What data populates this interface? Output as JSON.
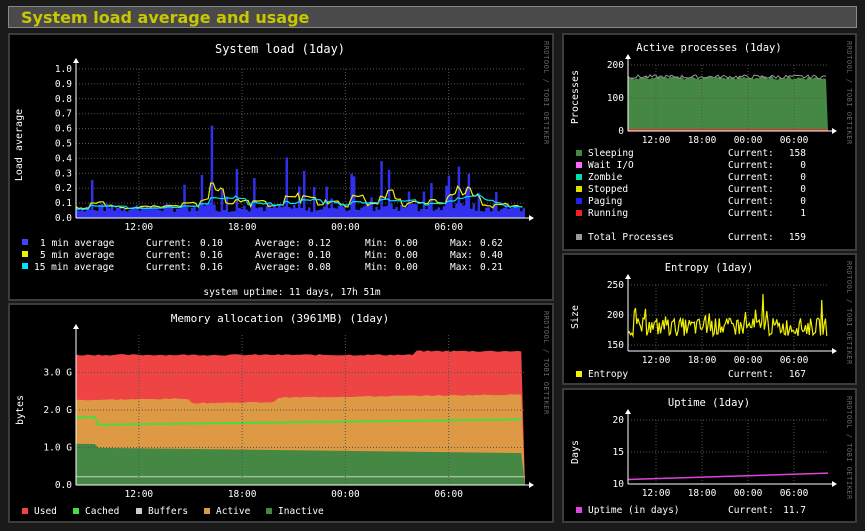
{
  "page": {
    "title": "System load average and usage",
    "side_text": "RRDTOOL / TOBI OETIKER"
  },
  "colors": {
    "background": "#000000",
    "grid": "#555555",
    "text": "#ffffff",
    "accent": "#c8c800"
  },
  "time_ticks": [
    "12:00",
    "18:00",
    "00:00",
    "06:00"
  ],
  "chart_data": [
    {
      "id": "load",
      "type": "area",
      "title": "System load   (1day)",
      "ylabel": "Load average",
      "ylim": [
        0,
        1.0
      ],
      "yticks": [
        "0.0",
        "0.1",
        "0.2",
        "0.3",
        "0.4",
        "0.5",
        "0.6",
        "0.7",
        "0.8",
        "0.9",
        "1.0"
      ],
      "legend_columns": [
        "Current:",
        "Average:",
        "Min:",
        "Max:"
      ],
      "series": [
        {
          "name": "1 min average",
          "color": "#4040ff",
          "current": "0.10",
          "average": "0.12",
          "min": "0.00",
          "max": "0.62"
        },
        {
          "name": "5 min average",
          "color": "#f0f000",
          "current": "0.16",
          "average": "0.10",
          "min": "0.00",
          "max": "0.40"
        },
        {
          "name": "15 min average",
          "color": "#00e0ff",
          "current": "0.16",
          "average": "0.08",
          "min": "0.00",
          "max": "0.21"
        }
      ],
      "footer": "system uptime: 11 days, 17h 51m"
    },
    {
      "id": "memory",
      "type": "area",
      "title": "Memory allocation (3961MB)  (1day)",
      "ylabel": "bytes",
      "ylim": [
        0,
        4.0
      ],
      "yticks": [
        "0.0",
        "1.0 G",
        "2.0 G",
        "3.0 G"
      ],
      "series": [
        {
          "name": "Used",
          "color": "#ee4444",
          "approx_gb": 3.5
        },
        {
          "name": "Cached",
          "color": "#44dd44",
          "approx_gb": 1.7
        },
        {
          "name": "Buffers",
          "color": "#cccccc",
          "approx_gb": 0.22
        },
        {
          "name": "Active",
          "color": "#dd9944",
          "approx_gb": 2.3
        },
        {
          "name": "Inactive",
          "color": "#448844",
          "approx_gb": 0.9
        }
      ]
    },
    {
      "id": "processes",
      "type": "area",
      "title": "Active processes   (1day)",
      "ylabel": "Processes",
      "ylim": [
        0,
        200
      ],
      "yticks": [
        "0",
        "100",
        "200"
      ],
      "series": [
        {
          "name": "Sleeping",
          "color": "#448844",
          "current_label": "Current:",
          "current": "158"
        },
        {
          "name": "Wait I/O",
          "color": "#ff66ff",
          "current_label": "Current:",
          "current": "0"
        },
        {
          "name": "Zombie",
          "color": "#00ddaa",
          "current_label": "Current:",
          "current": "0"
        },
        {
          "name": "Stopped",
          "color": "#e0e000",
          "current_label": "Current:",
          "current": "0"
        },
        {
          "name": "Paging",
          "color": "#2222ee",
          "current_label": "Current:",
          "current": "0"
        },
        {
          "name": "Running",
          "color": "#ee2222",
          "current_label": "Current:",
          "current": "1"
        }
      ],
      "total": {
        "name": "Total Processes",
        "color": "#999999",
        "current_label": "Current:",
        "current": "159"
      }
    },
    {
      "id": "entropy",
      "type": "line",
      "title": "Entropy   (1day)",
      "ylabel": "Size",
      "ylim": [
        140,
        250
      ],
      "yticks": [
        "150",
        "200",
        "250"
      ],
      "series": [
        {
          "name": "Entropy",
          "color": "#f0f000",
          "current_label": "Current:",
          "current": "167"
        }
      ]
    },
    {
      "id": "uptime",
      "type": "line",
      "title": "Uptime   (1day)",
      "ylabel": "Days",
      "ylim": [
        10,
        20
      ],
      "yticks": [
        "10",
        "15",
        "20"
      ],
      "series": [
        {
          "name": "Uptime   (in days)",
          "color": "#dd44dd",
          "current_label": "Current:",
          "current": "11.7"
        }
      ]
    }
  ]
}
